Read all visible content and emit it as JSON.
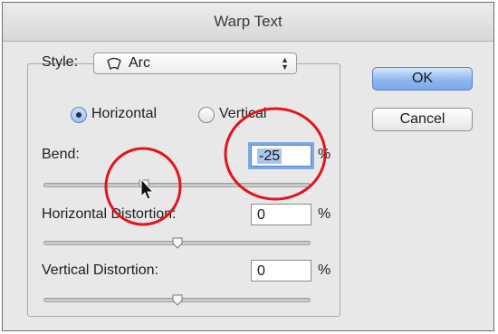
{
  "dialog": {
    "title": "Warp Text"
  },
  "style": {
    "label": "Style:",
    "selected": "Arc",
    "icon": "arc-warp-icon"
  },
  "orientation": {
    "options": [
      "Horizontal",
      "Vertical"
    ],
    "selected": "Horizontal"
  },
  "bend": {
    "label": "Bend:",
    "value": "-25",
    "unit": "%",
    "percent": -25
  },
  "horizontal_distortion": {
    "label": "Horizontal Distortion:",
    "value": "0",
    "unit": "%",
    "percent": 0
  },
  "vertical_distortion": {
    "label": "Vertical Distortion:",
    "value": "0",
    "unit": "%",
    "percent": 0
  },
  "buttons": {
    "ok": "OK",
    "cancel": "Cancel"
  },
  "colors": {
    "annotation": "#e3141c",
    "default_button": "#8fb7ef",
    "focus_ring": "#7fa8e0"
  }
}
